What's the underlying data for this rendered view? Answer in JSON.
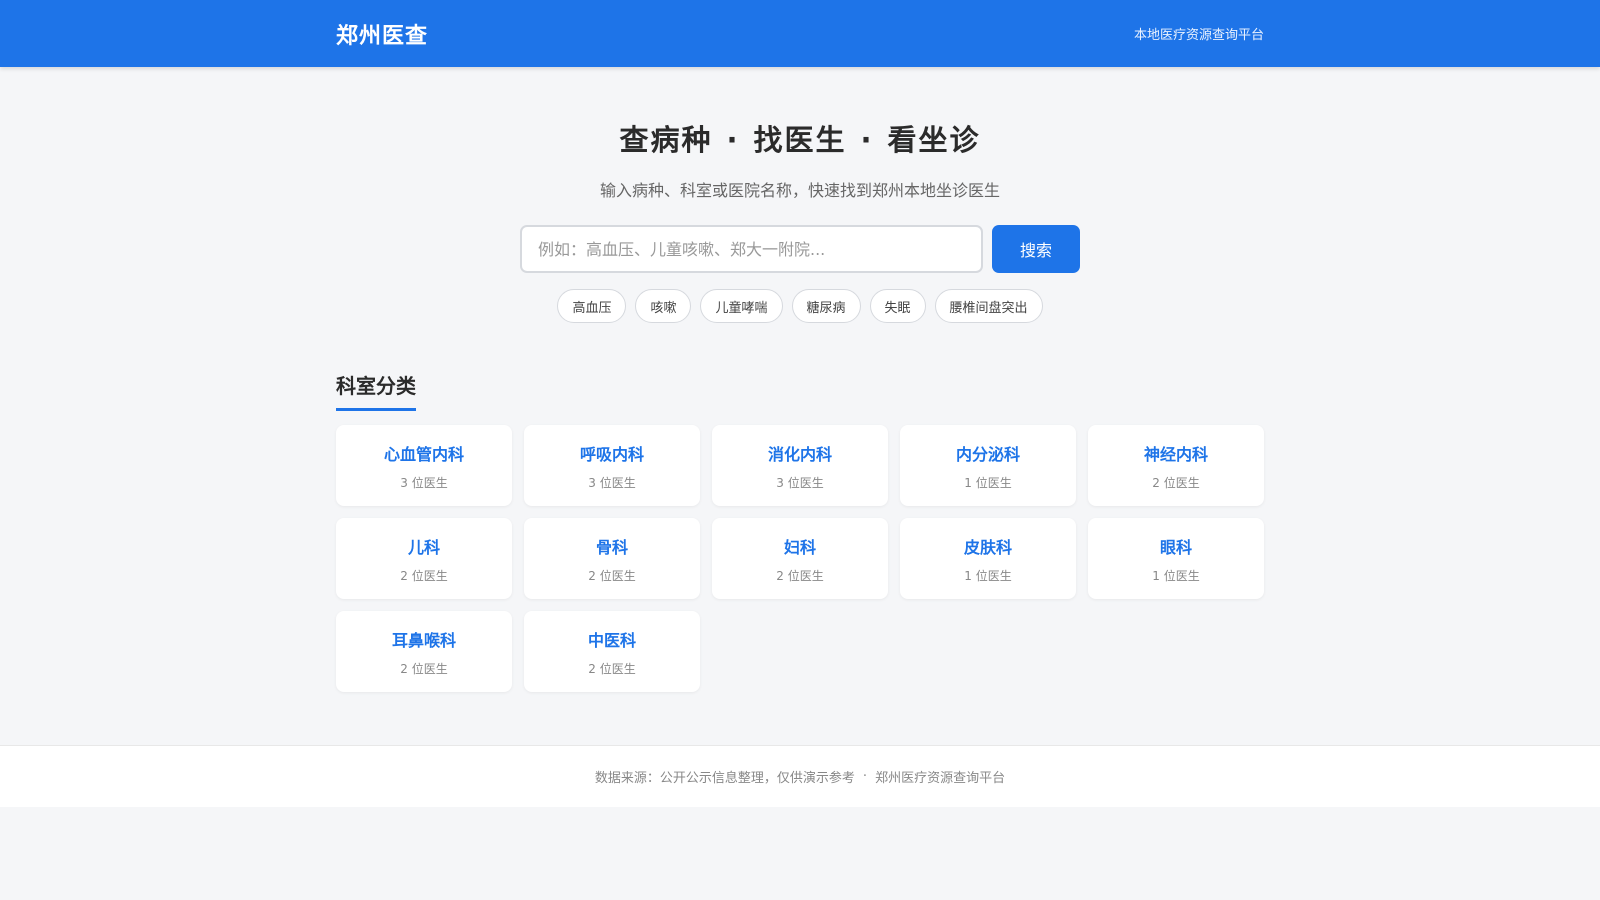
{
  "header": {
    "brand": "郑州医查",
    "tagline": "本地医疗资源查询平台"
  },
  "hero": {
    "title_parts": [
      "查病种",
      "找医生",
      "看坐诊"
    ],
    "separator": "·",
    "subtitle": "输入病种、科室或医院名称，快速找到郑州本地坐诊医生"
  },
  "search": {
    "placeholder": "例如：高血压、儿童咳嗽、郑大一附院...",
    "value": "",
    "button_label": "搜索"
  },
  "quick_tags": [
    "高血压",
    "咳嗽",
    "儿童哮喘",
    "糖尿病",
    "失眠",
    "腰椎间盘突出"
  ],
  "departments": {
    "title": "科室分类",
    "items": [
      {
        "name": "心血管内科",
        "count": "3 位医生"
      },
      {
        "name": "呼吸内科",
        "count": "3 位医生"
      },
      {
        "name": "消化内科",
        "count": "3 位医生"
      },
      {
        "name": "内分泌科",
        "count": "1 位医生"
      },
      {
        "name": "神经内科",
        "count": "2 位医生"
      },
      {
        "name": "儿科",
        "count": "2 位医生"
      },
      {
        "name": "骨科",
        "count": "2 位医生"
      },
      {
        "name": "妇科",
        "count": "2 位医生"
      },
      {
        "name": "皮肤科",
        "count": "1 位医生"
      },
      {
        "name": "眼科",
        "count": "1 位医生"
      },
      {
        "name": "耳鼻喉科",
        "count": "2 位医生"
      },
      {
        "name": "中医科",
        "count": "2 位医生"
      }
    ]
  },
  "footer": {
    "source": "数据来源：公开公示信息整理，仅供演示参考",
    "separator": "·",
    "platform": "郑州医疗资源查询平台"
  },
  "colors": {
    "primary": "#1e74e8",
    "background": "#f5f6f8"
  }
}
